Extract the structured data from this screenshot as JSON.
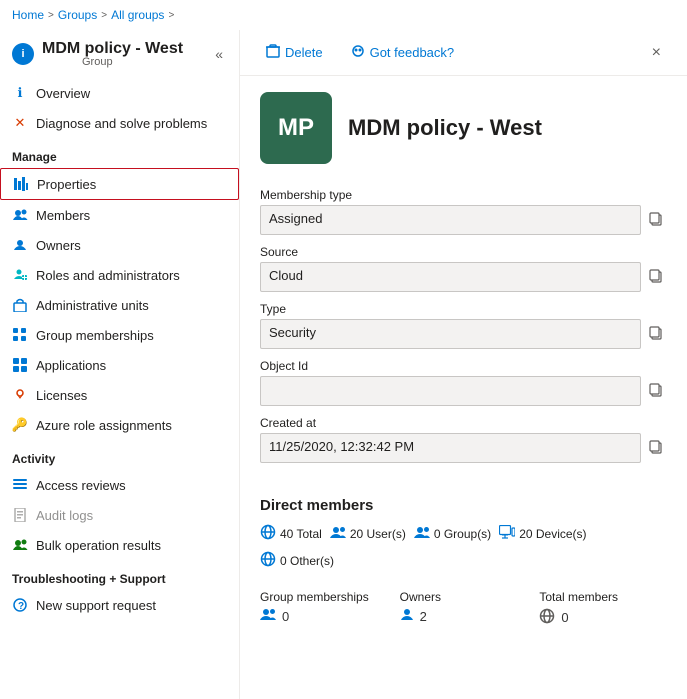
{
  "breadcrumb": {
    "items": [
      "Home",
      "Groups",
      "All groups"
    ],
    "separators": [
      ">",
      ">"
    ]
  },
  "sidebar": {
    "title": "MDM policy - West",
    "subtitle": "Group",
    "collapseLabel": "«",
    "nav": {
      "items": [
        {
          "id": "overview",
          "label": "Overview",
          "icon": "info",
          "active": false,
          "section": null
        },
        {
          "id": "diagnose",
          "label": "Diagnose and solve problems",
          "icon": "wrench",
          "active": false,
          "section": null
        },
        {
          "id": "manage-label",
          "label": "Manage",
          "isSection": true
        },
        {
          "id": "properties",
          "label": "Properties",
          "icon": "bar-chart",
          "active": true,
          "outlined": true
        },
        {
          "id": "members",
          "label": "Members",
          "icon": "people",
          "active": false
        },
        {
          "id": "owners",
          "label": "Owners",
          "icon": "people",
          "active": false
        },
        {
          "id": "roles",
          "label": "Roles and administrators",
          "icon": "person-shield",
          "active": false
        },
        {
          "id": "admin-units",
          "label": "Administrative units",
          "icon": "building",
          "active": false
        },
        {
          "id": "group-memberships",
          "label": "Group memberships",
          "icon": "grid",
          "active": false
        },
        {
          "id": "applications",
          "label": "Applications",
          "icon": "app-grid",
          "active": false
        },
        {
          "id": "licenses",
          "label": "Licenses",
          "icon": "license",
          "active": false
        },
        {
          "id": "azure-roles",
          "label": "Azure role assignments",
          "icon": "key",
          "active": false
        },
        {
          "id": "activity-label",
          "label": "Activity",
          "isSection": true
        },
        {
          "id": "access-reviews",
          "label": "Access reviews",
          "icon": "list",
          "active": false
        },
        {
          "id": "audit-logs",
          "label": "Audit logs",
          "icon": "document",
          "active": false
        },
        {
          "id": "bulk-ops",
          "label": "Bulk operation results",
          "icon": "people-settings",
          "active": false
        },
        {
          "id": "troubleshoot-label",
          "label": "Troubleshooting + Support",
          "isSection": true
        },
        {
          "id": "support",
          "label": "New support request",
          "icon": "question",
          "active": false
        }
      ]
    }
  },
  "toolbar": {
    "delete_label": "Delete",
    "feedback_label": "Got feedback?",
    "close_label": "×"
  },
  "profile": {
    "initials": "MP",
    "name": "MDM policy - West",
    "avatar_bg": "#2d6a4f"
  },
  "fields": [
    {
      "id": "membership-type",
      "label": "Membership type",
      "value": "Assigned"
    },
    {
      "id": "source",
      "label": "Source",
      "value": "Cloud"
    },
    {
      "id": "type",
      "label": "Type",
      "value": "Security"
    },
    {
      "id": "object-id",
      "label": "Object Id",
      "value": ""
    },
    {
      "id": "created-at",
      "label": "Created at",
      "value": "11/25/2020, 12:32:42 PM"
    }
  ],
  "direct_members": {
    "title": "Direct members",
    "stats": [
      {
        "id": "total",
        "icon": "globe",
        "label": "40 Total"
      },
      {
        "id": "users",
        "icon": "users",
        "label": "20 User(s)"
      },
      {
        "id": "groups",
        "icon": "groups",
        "label": "0 Group(s)"
      },
      {
        "id": "devices",
        "icon": "devices",
        "label": "20 Device(s)"
      },
      {
        "id": "others",
        "icon": "globe2",
        "label": "0 Other(s)"
      }
    ]
  },
  "bottom_stats": [
    {
      "id": "group-memberships",
      "label": "Group memberships",
      "icon": "users",
      "value": "0"
    },
    {
      "id": "owners",
      "label": "Owners",
      "icon": "person",
      "value": "2"
    },
    {
      "id": "total-members",
      "label": "Total members",
      "icon": "globe-gray",
      "value": "0"
    }
  ]
}
